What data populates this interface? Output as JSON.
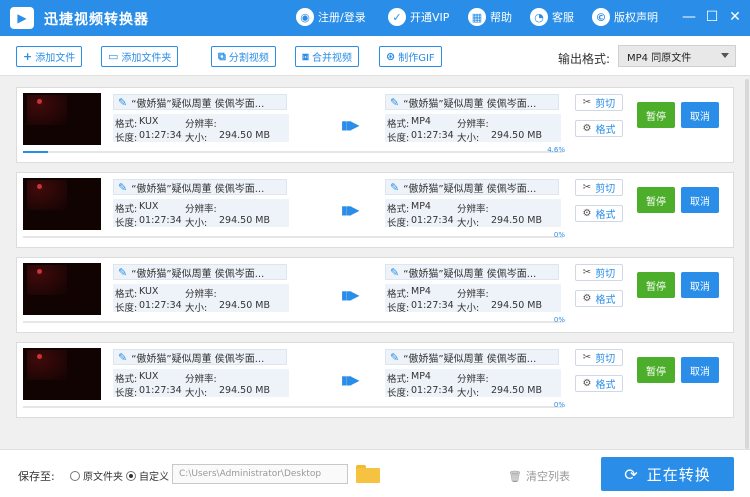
{
  "titlebar": {
    "logo_text": "▶",
    "title": "迅捷视频转换器",
    "links": [
      {
        "label": "注册/登录",
        "icon": "user-icon",
        "glyph": "◉"
      },
      {
        "label": "开通VIP",
        "icon": "vip-icon",
        "glyph": "✓"
      },
      {
        "label": "帮助",
        "icon": "help-icon",
        "glyph": "▦"
      },
      {
        "label": "客服",
        "icon": "headset-icon",
        "glyph": "◔"
      },
      {
        "label": "版权声明",
        "icon": "copyright-icon",
        "glyph": "©"
      }
    ],
    "min_glyph": "—",
    "max_glyph": "☐",
    "close_glyph": "✕"
  },
  "toolbar": {
    "add_file": "添加文件",
    "add_folder": "添加文件夹",
    "split_video": "分割视频",
    "merge_video": "合并视频",
    "make_gif": "制作GIF",
    "output_format_label": "输出格式:",
    "output_format_value": "MP4  同原文件"
  },
  "labels": {
    "format": "格式:",
    "resolution": "分辨率:",
    "duration": "长度:",
    "size": "大小:",
    "cut": "剪切",
    "fmt": "格式",
    "pause": "暂停",
    "cancel": "取消"
  },
  "items": [
    {
      "src_name": "“傲娇猫”疑似周董 侯佩岑面...",
      "src_format": "KUX",
      "src_duration": "01:27:34",
      "src_size": "294.50 MB",
      "dst_name": "“傲娇猫”疑似周董 侯佩岑面...",
      "dst_format": "MP4",
      "dst_duration": "01:27:34",
      "dst_size": "294.50 MB",
      "progress_text": "4.6%",
      "progress": 4.6
    },
    {
      "src_name": "“傲娇猫”疑似周董 侯佩岑面...",
      "src_format": "KUX",
      "src_duration": "01:27:34",
      "src_size": "294.50 MB",
      "dst_name": "“傲娇猫”疑似周董 侯佩岑面...",
      "dst_format": "MP4",
      "dst_duration": "01:27:34",
      "dst_size": "294.50 MB",
      "progress_text": "0%",
      "progress": 0
    },
    {
      "src_name": "“傲娇猫”疑似周董 侯佩岑面...",
      "src_format": "KUX",
      "src_duration": "01:27:34",
      "src_size": "294.50 MB",
      "dst_name": "“傲娇猫”疑似周董 侯佩岑面...",
      "dst_format": "MP4",
      "dst_duration": "01:27:34",
      "dst_size": "294.50 MB",
      "progress_text": "0%",
      "progress": 0
    },
    {
      "src_name": "“傲娇猫”疑似周董 侯佩岑面...",
      "src_format": "KUX",
      "src_duration": "01:27:34",
      "src_size": "294.50 MB",
      "dst_name": "“傲娇猫”疑似周董 侯佩岑面...",
      "dst_format": "MP4",
      "dst_duration": "01:27:34",
      "dst_size": "294.50 MB",
      "progress_text": "0%",
      "progress": 0
    }
  ],
  "footer": {
    "save_to": "保存至:",
    "opt_original": "原文件夹",
    "opt_custom": "自定义",
    "selected_option": "自定义",
    "path_value": "C:\\Users\\Administrator\\Desktop",
    "clear_list": "清空列表",
    "start": "正在转换"
  },
  "colors": {
    "accent": "#2a8ee8",
    "pause": "#4cae2a"
  }
}
